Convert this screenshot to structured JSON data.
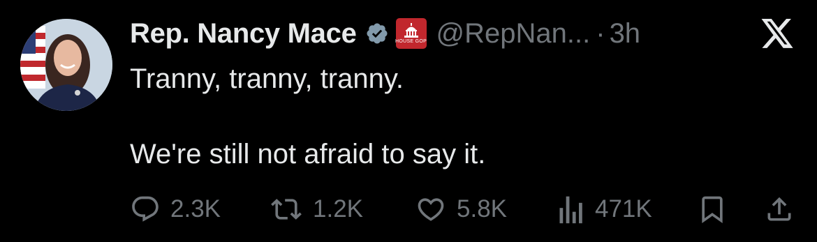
{
  "tweet": {
    "author": {
      "display_name": "Rep. Nancy Mace",
      "handle": "@RepNan...",
      "affiliation_label": "HOUSE GOP",
      "verified": true
    },
    "separator": "·",
    "time": "3h",
    "text": "Tranny, tranny, tranny.\n\nWe're still not afraid to say it.",
    "metrics": {
      "replies": "2.3K",
      "reposts": "1.2K",
      "likes": "5.8K",
      "views": "471K"
    }
  },
  "theme": {
    "background": "#000000",
    "text": "#e7e9ea",
    "secondary": "#71767b",
    "verified_badge": "#829aab",
    "affiliation_badge": "#c1272d"
  },
  "icons": [
    "x-logo-icon",
    "reply-icon",
    "repost-icon",
    "like-icon",
    "views-icon",
    "bookmark-icon",
    "share-icon",
    "verified-badge-icon"
  ]
}
